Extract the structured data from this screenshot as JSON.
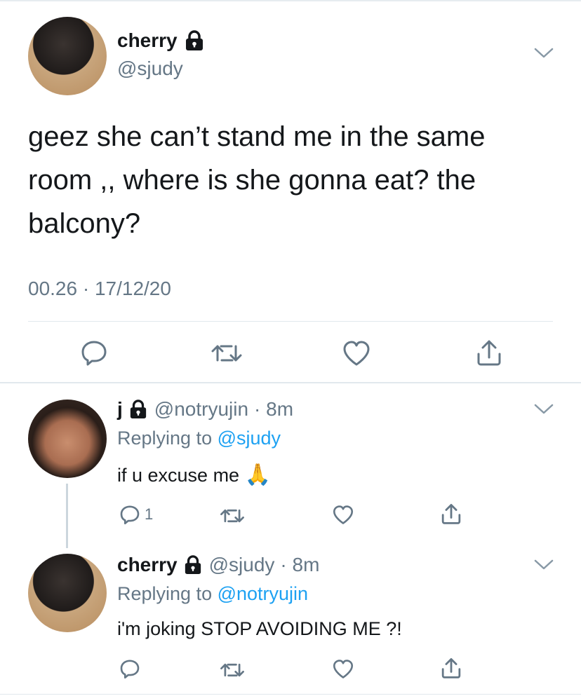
{
  "main_tweet": {
    "name": "cherry",
    "handle": "@sjudy",
    "text_line1": "geez she can’t stand me in the same",
    "text_line2": "room ,, where is she gonna eat? the",
    "text_line3": "balcony?",
    "timestamp": "00.26 · 17/12/20"
  },
  "replies": [
    {
      "name": "j",
      "handle": "@notryujin",
      "time": "· 8m",
      "replying_prefix": "Replying to",
      "replying_to": "@sjudy",
      "text": "if u excuse me",
      "emoji": "🙏",
      "reply_count": "1"
    },
    {
      "name": "cherry",
      "handle": "@sjudy",
      "time": "· 8m",
      "replying_prefix": "Replying to",
      "replying_to": "@notryujin",
      "text": "i'm joking STOP AVOIDING ME ?!"
    }
  ],
  "icons": [
    "lock-icon",
    "chevron-down-icon",
    "reply-icon",
    "retweet-icon",
    "like-icon",
    "share-icon"
  ],
  "colors": {
    "text": "#14171a",
    "secondary": "#657786",
    "link": "#1da1f2",
    "divider": "#e1e8ed"
  }
}
